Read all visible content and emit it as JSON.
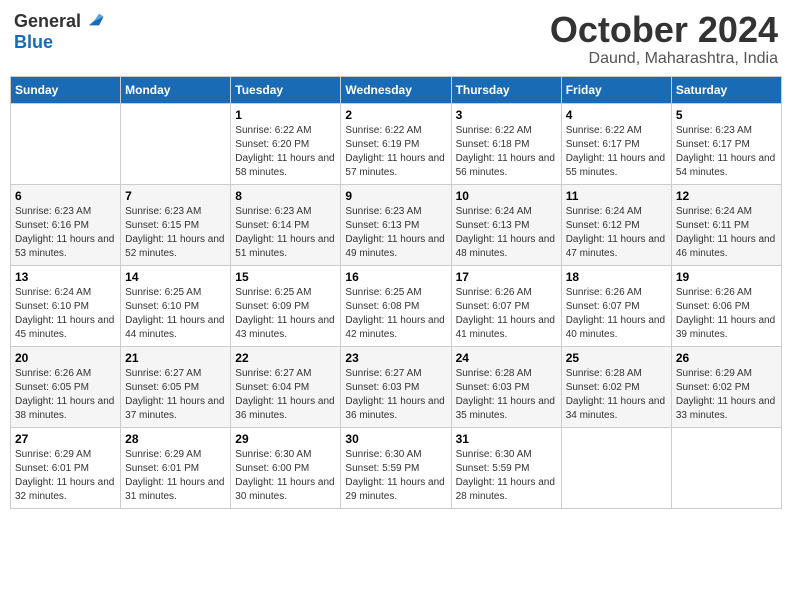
{
  "logo": {
    "general": "General",
    "blue": "Blue"
  },
  "title": {
    "month_year": "October 2024",
    "location": "Daund, Maharashtra, India"
  },
  "weekdays": [
    "Sunday",
    "Monday",
    "Tuesday",
    "Wednesday",
    "Thursday",
    "Friday",
    "Saturday"
  ],
  "weeks": [
    [
      {
        "day": "",
        "sunrise": "",
        "sunset": "",
        "daylight": ""
      },
      {
        "day": "",
        "sunrise": "",
        "sunset": "",
        "daylight": ""
      },
      {
        "day": "1",
        "sunrise": "Sunrise: 6:22 AM",
        "sunset": "Sunset: 6:20 PM",
        "daylight": "Daylight: 11 hours and 58 minutes."
      },
      {
        "day": "2",
        "sunrise": "Sunrise: 6:22 AM",
        "sunset": "Sunset: 6:19 PM",
        "daylight": "Daylight: 11 hours and 57 minutes."
      },
      {
        "day": "3",
        "sunrise": "Sunrise: 6:22 AM",
        "sunset": "Sunset: 6:18 PM",
        "daylight": "Daylight: 11 hours and 56 minutes."
      },
      {
        "day": "4",
        "sunrise": "Sunrise: 6:22 AM",
        "sunset": "Sunset: 6:17 PM",
        "daylight": "Daylight: 11 hours and 55 minutes."
      },
      {
        "day": "5",
        "sunrise": "Sunrise: 6:23 AM",
        "sunset": "Sunset: 6:17 PM",
        "daylight": "Daylight: 11 hours and 54 minutes."
      }
    ],
    [
      {
        "day": "6",
        "sunrise": "Sunrise: 6:23 AM",
        "sunset": "Sunset: 6:16 PM",
        "daylight": "Daylight: 11 hours and 53 minutes."
      },
      {
        "day": "7",
        "sunrise": "Sunrise: 6:23 AM",
        "sunset": "Sunset: 6:15 PM",
        "daylight": "Daylight: 11 hours and 52 minutes."
      },
      {
        "day": "8",
        "sunrise": "Sunrise: 6:23 AM",
        "sunset": "Sunset: 6:14 PM",
        "daylight": "Daylight: 11 hours and 51 minutes."
      },
      {
        "day": "9",
        "sunrise": "Sunrise: 6:23 AM",
        "sunset": "Sunset: 6:13 PM",
        "daylight": "Daylight: 11 hours and 49 minutes."
      },
      {
        "day": "10",
        "sunrise": "Sunrise: 6:24 AM",
        "sunset": "Sunset: 6:13 PM",
        "daylight": "Daylight: 11 hours and 48 minutes."
      },
      {
        "day": "11",
        "sunrise": "Sunrise: 6:24 AM",
        "sunset": "Sunset: 6:12 PM",
        "daylight": "Daylight: 11 hours and 47 minutes."
      },
      {
        "day": "12",
        "sunrise": "Sunrise: 6:24 AM",
        "sunset": "Sunset: 6:11 PM",
        "daylight": "Daylight: 11 hours and 46 minutes."
      }
    ],
    [
      {
        "day": "13",
        "sunrise": "Sunrise: 6:24 AM",
        "sunset": "Sunset: 6:10 PM",
        "daylight": "Daylight: 11 hours and 45 minutes."
      },
      {
        "day": "14",
        "sunrise": "Sunrise: 6:25 AM",
        "sunset": "Sunset: 6:10 PM",
        "daylight": "Daylight: 11 hours and 44 minutes."
      },
      {
        "day": "15",
        "sunrise": "Sunrise: 6:25 AM",
        "sunset": "Sunset: 6:09 PM",
        "daylight": "Daylight: 11 hours and 43 minutes."
      },
      {
        "day": "16",
        "sunrise": "Sunrise: 6:25 AM",
        "sunset": "Sunset: 6:08 PM",
        "daylight": "Daylight: 11 hours and 42 minutes."
      },
      {
        "day": "17",
        "sunrise": "Sunrise: 6:26 AM",
        "sunset": "Sunset: 6:07 PM",
        "daylight": "Daylight: 11 hours and 41 minutes."
      },
      {
        "day": "18",
        "sunrise": "Sunrise: 6:26 AM",
        "sunset": "Sunset: 6:07 PM",
        "daylight": "Daylight: 11 hours and 40 minutes."
      },
      {
        "day": "19",
        "sunrise": "Sunrise: 6:26 AM",
        "sunset": "Sunset: 6:06 PM",
        "daylight": "Daylight: 11 hours and 39 minutes."
      }
    ],
    [
      {
        "day": "20",
        "sunrise": "Sunrise: 6:26 AM",
        "sunset": "Sunset: 6:05 PM",
        "daylight": "Daylight: 11 hours and 38 minutes."
      },
      {
        "day": "21",
        "sunrise": "Sunrise: 6:27 AM",
        "sunset": "Sunset: 6:05 PM",
        "daylight": "Daylight: 11 hours and 37 minutes."
      },
      {
        "day": "22",
        "sunrise": "Sunrise: 6:27 AM",
        "sunset": "Sunset: 6:04 PM",
        "daylight": "Daylight: 11 hours and 36 minutes."
      },
      {
        "day": "23",
        "sunrise": "Sunrise: 6:27 AM",
        "sunset": "Sunset: 6:03 PM",
        "daylight": "Daylight: 11 hours and 36 minutes."
      },
      {
        "day": "24",
        "sunrise": "Sunrise: 6:28 AM",
        "sunset": "Sunset: 6:03 PM",
        "daylight": "Daylight: 11 hours and 35 minutes."
      },
      {
        "day": "25",
        "sunrise": "Sunrise: 6:28 AM",
        "sunset": "Sunset: 6:02 PM",
        "daylight": "Daylight: 11 hours and 34 minutes."
      },
      {
        "day": "26",
        "sunrise": "Sunrise: 6:29 AM",
        "sunset": "Sunset: 6:02 PM",
        "daylight": "Daylight: 11 hours and 33 minutes."
      }
    ],
    [
      {
        "day": "27",
        "sunrise": "Sunrise: 6:29 AM",
        "sunset": "Sunset: 6:01 PM",
        "daylight": "Daylight: 11 hours and 32 minutes."
      },
      {
        "day": "28",
        "sunrise": "Sunrise: 6:29 AM",
        "sunset": "Sunset: 6:01 PM",
        "daylight": "Daylight: 11 hours and 31 minutes."
      },
      {
        "day": "29",
        "sunrise": "Sunrise: 6:30 AM",
        "sunset": "Sunset: 6:00 PM",
        "daylight": "Daylight: 11 hours and 30 minutes."
      },
      {
        "day": "30",
        "sunrise": "Sunrise: 6:30 AM",
        "sunset": "Sunset: 5:59 PM",
        "daylight": "Daylight: 11 hours and 29 minutes."
      },
      {
        "day": "31",
        "sunrise": "Sunrise: 6:30 AM",
        "sunset": "Sunset: 5:59 PM",
        "daylight": "Daylight: 11 hours and 28 minutes."
      },
      {
        "day": "",
        "sunrise": "",
        "sunset": "",
        "daylight": ""
      },
      {
        "day": "",
        "sunrise": "",
        "sunset": "",
        "daylight": ""
      }
    ]
  ]
}
